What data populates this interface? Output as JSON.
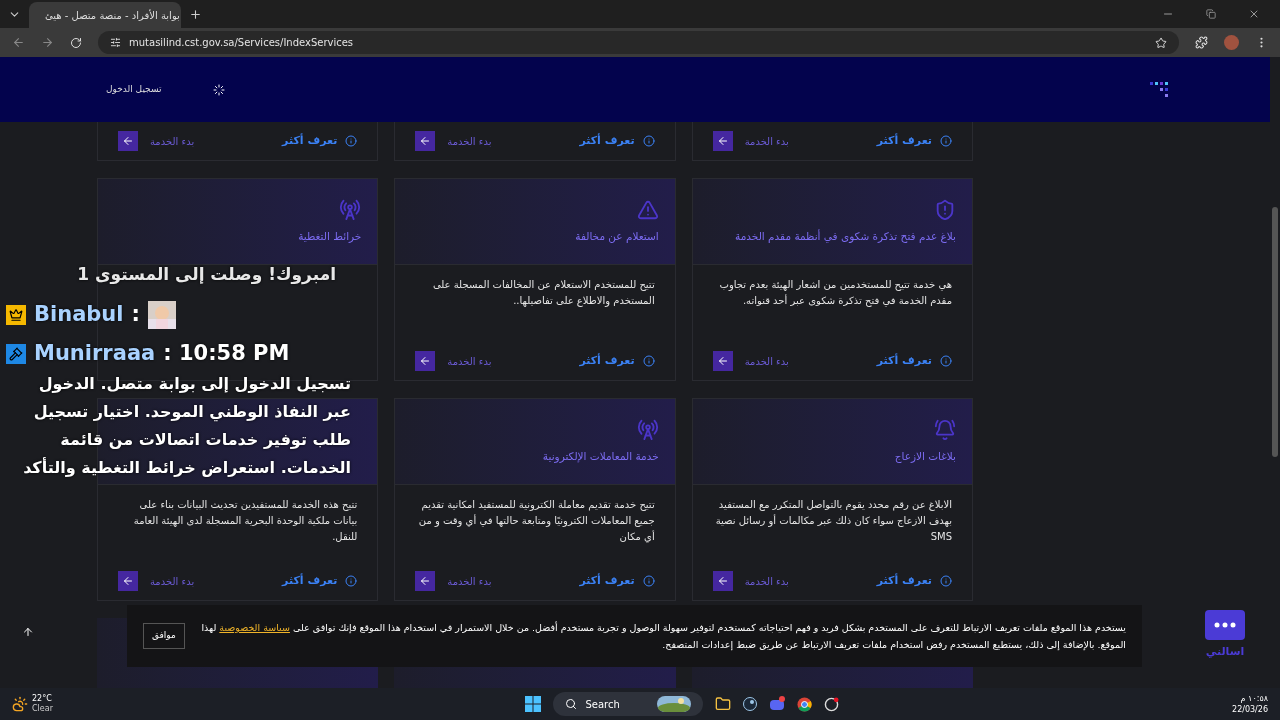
{
  "browser": {
    "tab_title": "بوابة الأفراد - منصة متصل - هيئ",
    "url": "mutasilind.cst.gov.sa/Services/IndexServices"
  },
  "header": {
    "login": "تسجيل الدخول"
  },
  "card_rows": [
    {
      "kind": "footer_only",
      "cards": [
        {
          "learn_more": "تعرف أكثر",
          "start": "بدء الخدمة"
        },
        {
          "learn_more": "تعرف أكثر",
          "start": "بدء الخدمة"
        },
        {
          "learn_more": "تعرف أكثر",
          "start": "بدء الخدمة"
        }
      ]
    },
    {
      "kind": "full",
      "cards": [
        {
          "kind": "shield",
          "title": "بلاغ عدم فتح تذكرة شكوى في أنظمة مقدم الخدمة",
          "description": "هي خدمة تتيح للمستخدمين من اشعار الهيئة بعدم تجاوب مقدم الخدمة في فتح تذكرة شكوى عبر أحد قنواته.",
          "learn_more": "تعرف أكثر",
          "start": "بدء الخدمة"
        },
        {
          "kind": "warning",
          "title": "استعلام عن مخالفة",
          "description": "تتيح للمستخدم الاستعلام عن المخالفات المسجلة على المستخدم والاطلاع على تفاصيلها..",
          "learn_more": "تعرف أكثر",
          "start": "بدء الخدمة"
        },
        {
          "kind": "antenna",
          "title": "خرائط التغطية"
        }
      ]
    },
    {
      "kind": "full",
      "cards": [
        {
          "kind": "bell",
          "title": "بلاغات الازعاج",
          "description": "الابلاغ عن رقم محدد يقوم بالتواصل المتكرر مع المستفيد بهدف الازعاج سواء كان ذلك عبر مكالمات أو رسائل نصية SMS",
          "learn_more": "تعرف أكثر",
          "start": "بدء الخدمة"
        },
        {
          "kind": "antenna",
          "title": "خدمة المعاملات الإلكترونية",
          "description": "تتيح خدمة تقديم معاملة الكترونية للمستفيد امكانية تقديم جميع المعاملات الكترونيًا ومتابعة حالتها في أي وقت و من أي مكان",
          "learn_more": "تعرف أكثر",
          "start": "بدء الخدمة"
        },
        {
          "description": "تتيح هذه الخدمة للمستفيدين تحديث البيانات بناء على بيانات ملكية الوحدة البحرية المسجلة لدى الهيئة العامة للنقل.",
          "learn_more": "تعرف أكثر",
          "start": "بدء الخدمة"
        }
      ]
    }
  ],
  "chat_overlay": {
    "messages": [
      {
        "kind": "notice",
        "text": "امبروك! وصلت إلى المستوى 1"
      },
      {
        "kind": "emote",
        "user": "Binabul",
        "separator": ":"
      },
      {
        "kind": "message",
        "user": "Munirraaa",
        "time": ": 10:58 PM",
        "text": "تسجيل الدخول إلى بوابة متصل. الدخول عبر النفاذ الوطني الموحد. اختيار تسجيل طلب توفير خدمات اتصالات من قائمة الخدمات. استعراض خرائط التغطية والتأكد"
      }
    ]
  },
  "cookie_banner": {
    "text_before": "يستخدم هذا الموقع ملفات تعريف الارتباط للتعرف على المستخدم بشكل فريد و فهم احتياجاته كمستخدم لتوفير سهولة الوصول و تجربة مستخدم أفضل. من خلال الاستمرار في استخدام هذا الموقع فإنك توافق على",
    "link": "سياسة الخصوصية",
    "text_after": "لهذا الموقع. بالإضافة إلى ذلك، يستطيع المستخدم رفض استخدام ملفات تعريف الارتباط عن طريق ضبط إعدادات المتصفح.",
    "accept": "موافق"
  },
  "assistant": {
    "label": "اسالني"
  },
  "taskbar": {
    "temperature": "22°C",
    "weather": "Clear",
    "search": "Search",
    "time": "١٠:٥٨ م",
    "date": "22/03/26"
  }
}
